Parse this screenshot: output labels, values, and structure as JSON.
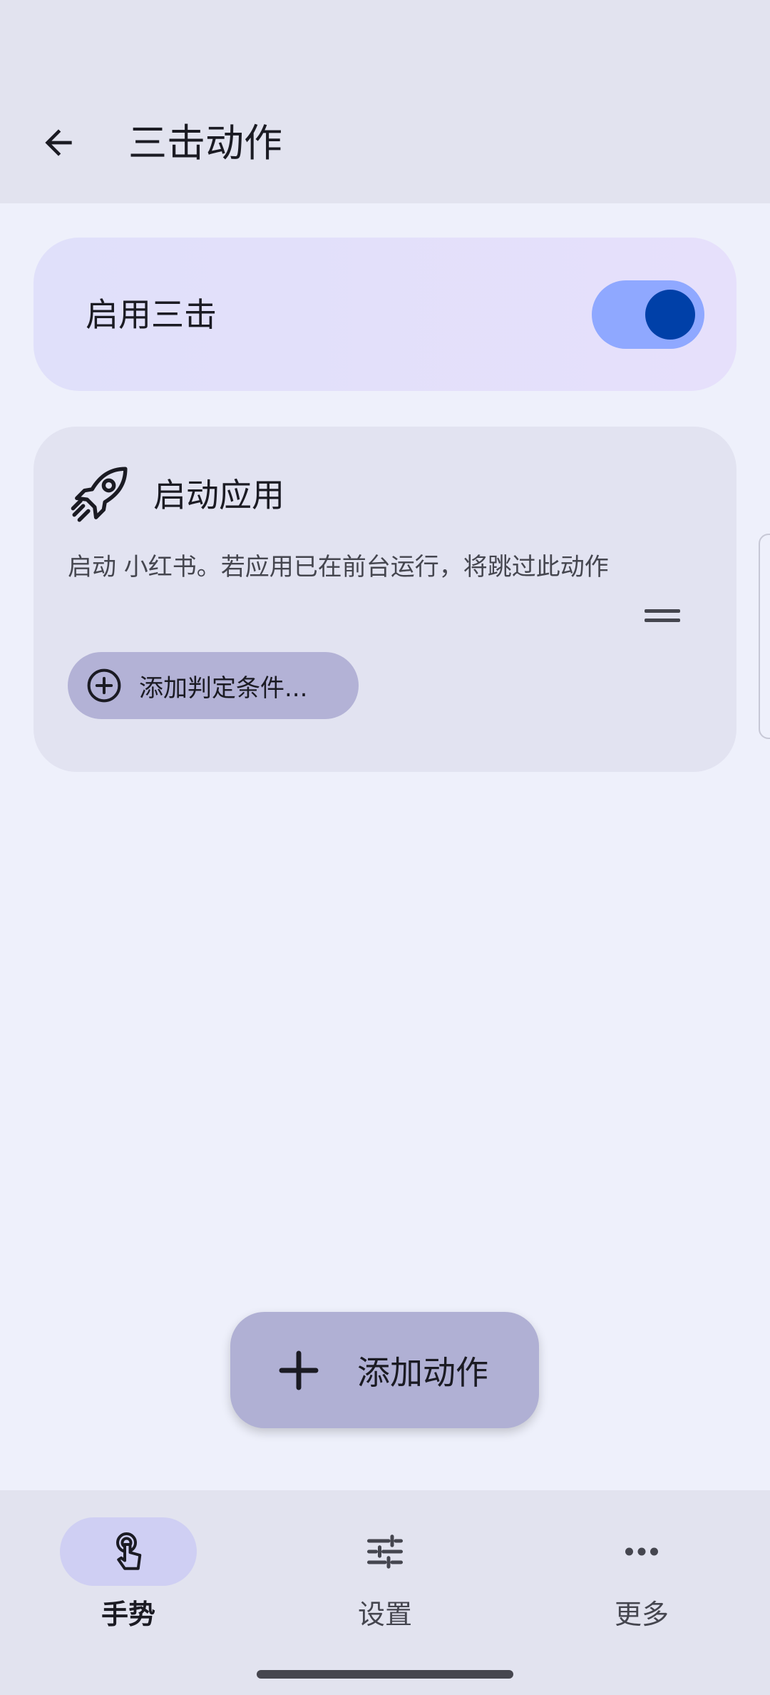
{
  "header": {
    "title": "三击动作"
  },
  "toggle_card": {
    "label": "启用三击",
    "enabled": true
  },
  "action_card": {
    "title": "启动应用",
    "description": "启动 小红书。若应用已在前台运行，将跳过此动作",
    "add_condition_label": "添加判定条件..."
  },
  "fab": {
    "label": "添加动作"
  },
  "bottom_nav": {
    "items": [
      {
        "label": "手势",
        "icon": "touch-gesture-icon",
        "active": true
      },
      {
        "label": "设置",
        "icon": "sliders-icon",
        "active": false
      },
      {
        "label": "更多",
        "icon": "more-dots-icon",
        "active": false
      }
    ]
  },
  "colors": {
    "background": "#eef0fb",
    "topbar": "#e2e3ef",
    "switch_track": "#8fa8ff",
    "switch_knob": "#0040a8",
    "fab": "#b0b0d4",
    "nav_active_pill": "#cfcff3"
  }
}
